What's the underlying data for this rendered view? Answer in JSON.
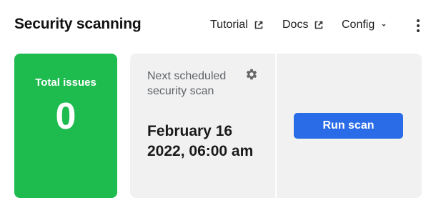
{
  "header": {
    "title": "Security scanning",
    "links": [
      {
        "label": "Tutorial",
        "icon": "external-link-icon"
      },
      {
        "label": "Docs",
        "icon": "external-link-icon"
      }
    ],
    "config_label": "Config",
    "config_icon": "chevron-down-icon",
    "more_icon": "kebab-menu-icon"
  },
  "issues": {
    "label": "Total issues",
    "count": "0",
    "color": "#1ebb4f"
  },
  "scan": {
    "label": "Next scheduled security scan",
    "settings_icon": "gear-icon",
    "date": "February 16 2022, 06:00 am",
    "button_label": "Run scan",
    "button_color": "#2a6ce8"
  }
}
